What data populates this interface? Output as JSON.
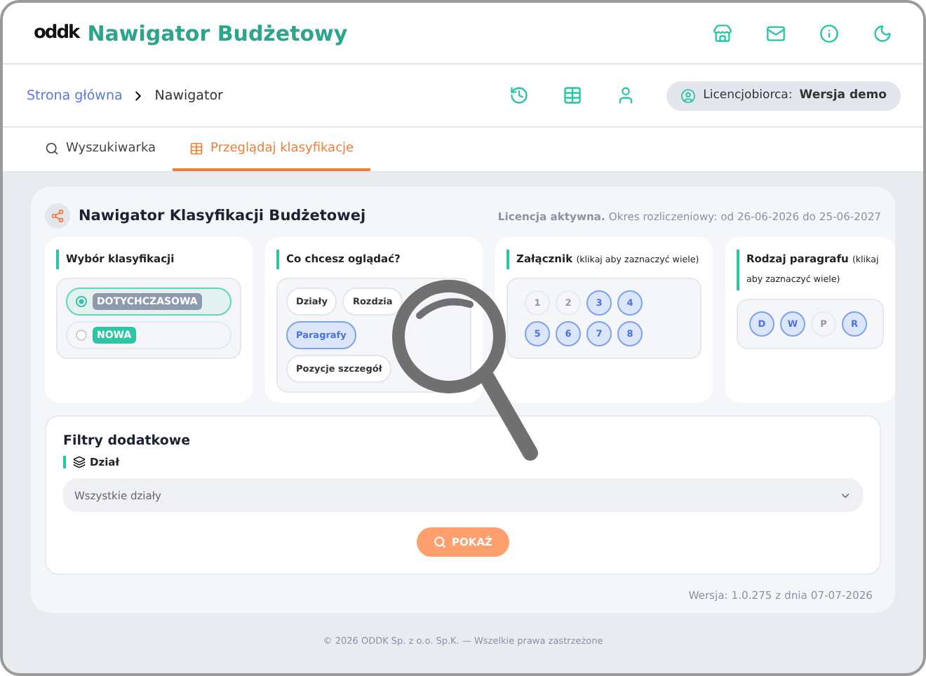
{
  "header": {
    "logo": "oddk",
    "title": "Nawigator Budżetowy"
  },
  "breadcrumb": [
    {
      "label": "Strona główna",
      "link": true
    },
    {
      "label": "Nawigator",
      "link": false
    }
  ],
  "license_badge": {
    "label": "Licencjobiorca:",
    "value": "Wersja demo"
  },
  "tabs": [
    {
      "label": "Wyszukiwarka",
      "selected": false,
      "kind": "search"
    },
    {
      "label": "Przeglądaj klasyfikacje",
      "selected": true,
      "kind": "table"
    }
  ],
  "panel": {
    "title": "Nawigator Klasyfikacji Budżetowej",
    "license_status": "Licencja aktywna.",
    "license_period": "Okres rozliczeniowy: od 26-06-2026 do 25-06-2027"
  },
  "classification": {
    "title": "Wybór klasyfikacji",
    "options": [
      {
        "label": "DOTYCHCZASOWA",
        "selected": true,
        "color": "#8e9aae"
      },
      {
        "label": "NOWA",
        "selected": false,
        "color": "#2ec4a6"
      }
    ]
  },
  "view": {
    "title": "Co chcesz oglądać?",
    "options": [
      {
        "label": "Działy",
        "selected": false
      },
      {
        "label": "Rozdzia",
        "selected": false
      },
      {
        "label": "Paragrafy",
        "selected": true
      },
      {
        "label": "Pozycje szczegół",
        "selected": false
      }
    ]
  },
  "attachment": {
    "title": "Załącznik",
    "hint": "(klikaj aby zaznaczyć wiele)",
    "options": [
      {
        "label": "1",
        "selected": false
      },
      {
        "label": "2",
        "selected": false
      },
      {
        "label": "3",
        "selected": true
      },
      {
        "label": "4",
        "selected": true
      },
      {
        "label": "5",
        "selected": true
      },
      {
        "label": "6",
        "selected": true
      },
      {
        "label": "7",
        "selected": true
      },
      {
        "label": "8",
        "selected": true
      }
    ]
  },
  "paragraph_type": {
    "title": "Rodzaj paragrafu",
    "hint": "(klikaj aby zaznaczyć wiele)",
    "options": [
      {
        "label": "D",
        "selected": true
      },
      {
        "label": "W",
        "selected": true
      },
      {
        "label": "P",
        "selected": false
      },
      {
        "label": "R",
        "selected": true
      }
    ]
  },
  "filters": {
    "title": "Filtry dodatkowe",
    "field_label": "Dział",
    "select_value": "Wszystkie działy",
    "button": "POKAŻ"
  },
  "version": "Wersja: 1.0.275 z dnia 07-07-2026",
  "footer": "© 2026 ODDK Sp. z o.o. Sp.K. — Wszelkie prawa zastrzeżone"
}
